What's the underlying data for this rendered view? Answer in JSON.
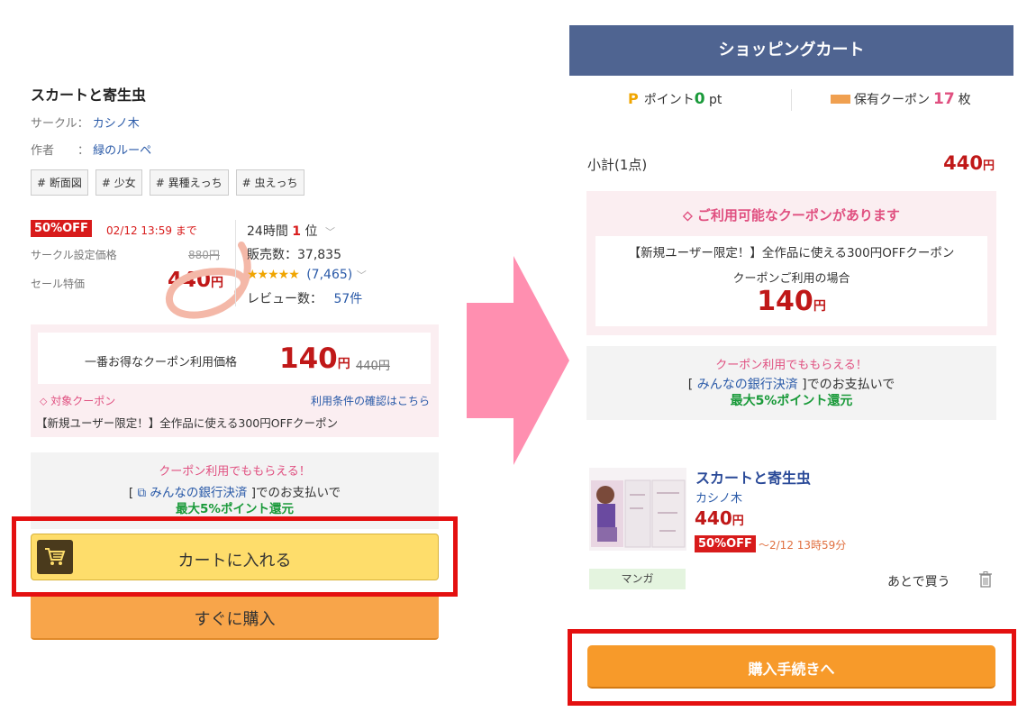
{
  "left": {
    "title": "スカートと寄生虫",
    "circle_label": "サークル：",
    "circle_name": "カシノ木",
    "author_label": "作者　　：",
    "author_name": "緑のルーペ",
    "tags": [
      "# 断面図",
      "# 少女",
      "# 異種えっち",
      "# 虫えっち"
    ],
    "sale_badge": "50%OFF",
    "sale_until": "02/12 13:59 まで",
    "circle_price_label": "サークル設定価格",
    "circle_price": "880円",
    "sale_price_label": "セール特価",
    "sale_price": "440",
    "yen": "円",
    "rank_prefix": "24時間",
    "rank_num": "1",
    "rank_suffix": "位",
    "sales": "販売数：37,835",
    "stars": "★★★★★",
    "rating_count": "(7,465)",
    "reviews_label": "レビュー数：",
    "reviews_count": "57件",
    "best_coupon_label": "一番お得なクーポン利用価格",
    "best_coupon_price": "140",
    "best_coupon_old": "440円",
    "target_coupon": "対象クーポン",
    "terms_link": "利用条件の確認はこちら",
    "coupon_desc": "【新規ユーザー限定！】全作品に使える300円OFFクーポン",
    "bank_line1": "クーポン利用でももらえる！",
    "bank_line2_pre": "[ ",
    "bank_link": "みんなの銀行決済",
    "bank_line2_post": " ]でのお支払いで",
    "bank_line3": "最大5%ポイント還元",
    "cart_button": "カートに入れる",
    "buy_now": "すぐに購入"
  },
  "right": {
    "header": "ショッピングカート",
    "points_icon": "P",
    "points_label": "ポイント",
    "points_value": "0",
    "points_unit": "pt",
    "coupons_label": "保有クーポン",
    "coupons_value": "17",
    "coupons_unit": "枚",
    "subtotal_label": "小計(1点)",
    "subtotal_value": "440",
    "yen": "円",
    "coupon_avail": "ご利用可能なクーポンがあります",
    "coupon_desc": "【新規ユーザー限定！】全作品に使える300円OFFクーポン",
    "coupon_use": "クーポンご利用の場合",
    "coupon_price": "140",
    "bank_line1": "クーポン利用でももらえる！",
    "bank_line2_pre": "[ ",
    "bank_link": "みんなの銀行決済",
    "bank_line2_post": " ]でのお支払いで",
    "bank_line3": "最大5%ポイント還元",
    "product_title": "スカートと寄生虫",
    "product_circle": "カシノ木",
    "product_price": "440",
    "product_badge": "50%OFF",
    "product_until": "～2/12 13時59分",
    "genre": "マンガ",
    "later": "あとで買う",
    "proceed": "購入手続きへ"
  },
  "colors": {
    "sale_red": "#c01818",
    "header_blue": "#4f6491",
    "arrow_pink": "#ff8fb0",
    "highlight_red": "#e41010",
    "cart_yellow": "#fedd6b",
    "buy_orange": "#f79a2a"
  },
  "icons": {
    "cart": "cart-icon",
    "trash": "trash-icon",
    "coupon": "coupon-tag-icon",
    "link": "external-link-icon",
    "arrow": "right-arrow"
  }
}
